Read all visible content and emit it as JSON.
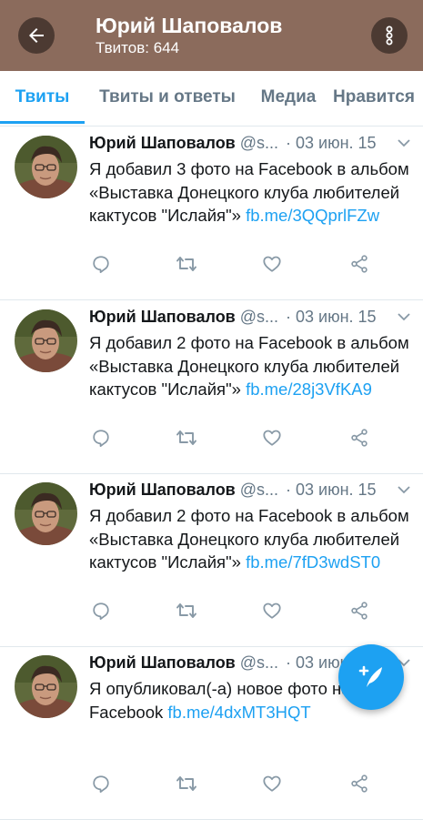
{
  "header": {
    "title": "Юрий Шаповалов",
    "subtitle": "Твитов: 644",
    "background": "#8b6b5c",
    "back_icon": "arrow-left-icon",
    "more_icon": "more-vertical-icon"
  },
  "tabs": [
    {
      "label": "Твиты",
      "active": true
    },
    {
      "label": "Твиты и ответы",
      "active": false
    },
    {
      "label": "Медиа",
      "active": false
    },
    {
      "label": "Нравится",
      "active": false
    }
  ],
  "accent_color": "#1da1f2",
  "tweets": [
    {
      "name": "Юрий Шаповалов",
      "handle": "@s...",
      "date": "· 03 июн. 15",
      "text": "Я добавил 3 фото на Facebook в альбом «Выставка Донецкого клуба любителей кактусов \"Ислайя\"» ",
      "link": "fb.me/3QQprlFZw"
    },
    {
      "name": "Юрий Шаповалов",
      "handle": "@s...",
      "date": "· 03 июн. 15",
      "text": "Я добавил 2 фото на Facebook в альбом «Выставка Донецкого клуба любителей кактусов \"Ислайя\"» ",
      "link": "fb.me/28j3VfKA9"
    },
    {
      "name": "Юрий Шаповалов",
      "handle": "@s...",
      "date": "· 03 июн. 15",
      "text": "Я добавил 2 фото на Facebook в альбом «Выставка Донецкого клуба любителей кактусов \"Ислайя\"» ",
      "link": "fb.me/7fD3wdST0"
    },
    {
      "name": "Юрий Шаповалов",
      "handle": "@s...",
      "date": "· 03 июн. 15",
      "text": "Я опубликовал(-а) новое фото на Facebook ",
      "link": "fb.me/4dxMT3HQT"
    }
  ],
  "fab": {
    "icon": "compose-tweet-icon"
  }
}
